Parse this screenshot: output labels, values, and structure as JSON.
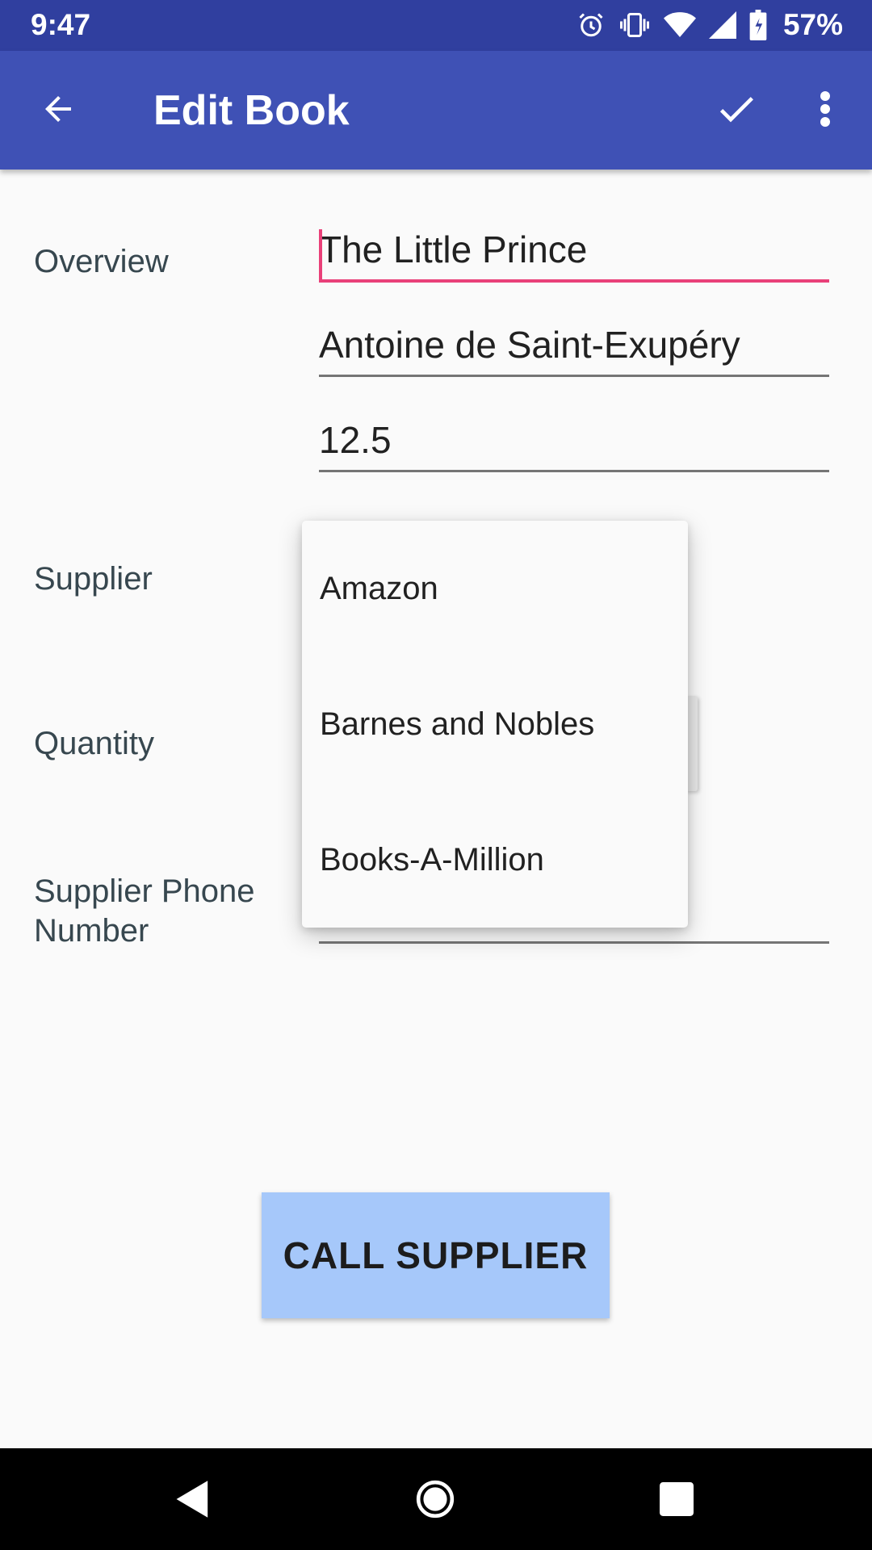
{
  "status_bar": {
    "time": "9:47",
    "battery": "57%",
    "icons": [
      "alarm-icon",
      "vibrate-icon",
      "wifi-icon",
      "signal-icon",
      "battery-icon"
    ]
  },
  "app_bar": {
    "title": "Edit Book",
    "icons": [
      "back-arrow-icon",
      "check-icon",
      "more-vert-icon"
    ],
    "color": "#3f51b5",
    "status_color": "#303f9f"
  },
  "form": {
    "overview_label": "Overview",
    "title_value": "The Little Prince",
    "author_value": "Antoine de Saint-Exupéry",
    "price_value": "12.5",
    "supplier_label": "Supplier",
    "quantity_label": "Quantity",
    "phone_label": "Supplier Phone Number",
    "accent_color": "#e94079"
  },
  "dropdown": {
    "options": [
      "Amazon",
      "Barnes and Nobles",
      "Books-A-Million"
    ]
  },
  "call_button": {
    "label": "CALL SUPPLIER",
    "color": "#a6c8fa"
  },
  "nav_bar": {
    "icons": [
      "back-triangle-icon",
      "home-circle-icon",
      "recents-square-icon"
    ]
  }
}
